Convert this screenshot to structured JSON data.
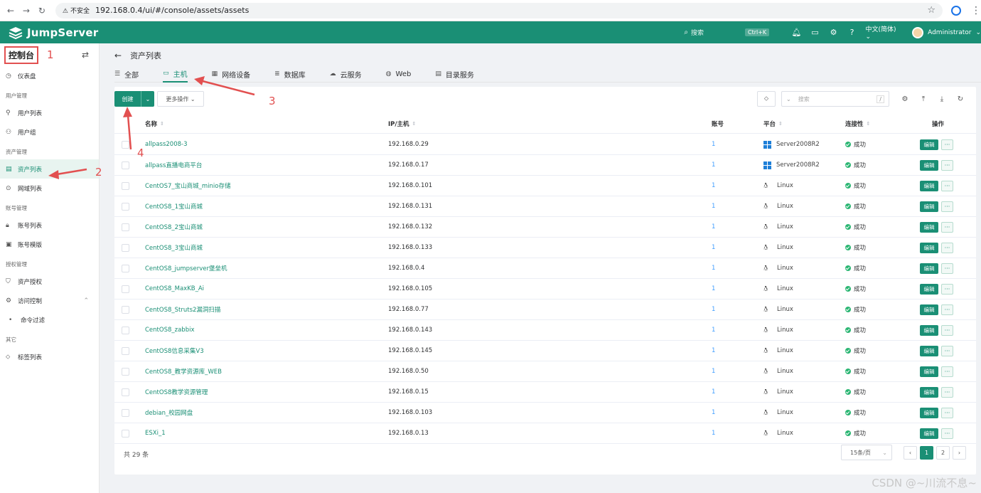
{
  "browser": {
    "security_label": "不安全",
    "url": "192.168.0.4/ui/#/console/assets/assets"
  },
  "header": {
    "logo_text": "JumpServer",
    "search_placeholder": "搜索",
    "search_shortcut": "Ctrl+K",
    "language": "中文(简体)",
    "username": "Administrator"
  },
  "sidebar": {
    "title": "控制台",
    "items": [
      {
        "type": "item",
        "label": "仪表盘",
        "icon": "dashboard-icon"
      },
      {
        "type": "group",
        "label": "用户管理"
      },
      {
        "type": "item",
        "label": "用户列表",
        "icon": "user-icon"
      },
      {
        "type": "item",
        "label": "用户组",
        "icon": "user-group-icon"
      },
      {
        "type": "group",
        "label": "资产管理"
      },
      {
        "type": "item",
        "label": "资产列表",
        "icon": "asset-icon",
        "active": true
      },
      {
        "type": "item",
        "label": "网域列表",
        "icon": "domain-icon"
      },
      {
        "type": "group",
        "label": "账号管理"
      },
      {
        "type": "item",
        "label": "账号列表",
        "icon": "lock-icon"
      },
      {
        "type": "item",
        "label": "账号模版",
        "icon": "template-icon"
      },
      {
        "type": "group",
        "label": "授权管理"
      },
      {
        "type": "item",
        "label": "资产授权",
        "icon": "shield-icon"
      },
      {
        "type": "item",
        "label": "访问控制",
        "icon": "access-control-icon",
        "expandable": true
      },
      {
        "type": "subitem",
        "label": "命令过滤"
      },
      {
        "type": "group",
        "label": "其它"
      },
      {
        "type": "item",
        "label": "标签列表",
        "icon": "tag-icon"
      }
    ]
  },
  "page": {
    "breadcrumb": "资产列表",
    "tabs": [
      {
        "label": "全部",
        "icon": "list-icon"
      },
      {
        "label": "主机",
        "icon": "host-icon",
        "active": true
      },
      {
        "label": "网络设备",
        "icon": "network-device-icon"
      },
      {
        "label": "数据库",
        "icon": "database-icon"
      },
      {
        "label": "云服务",
        "icon": "cloud-icon"
      },
      {
        "label": "Web",
        "icon": "globe-icon"
      },
      {
        "label": "目录服务",
        "icon": "directory-icon"
      }
    ]
  },
  "toolbar": {
    "create_label": "创建",
    "more_label": "更多操作",
    "search_placeholder": "搜索",
    "search_slash": "/"
  },
  "table": {
    "columns": {
      "name": "名称",
      "ip": "IP/主机",
      "accounts": "账号",
      "platform": "平台",
      "connectivity": "连接性",
      "actions": "操作"
    },
    "edit_label": "编辑",
    "more_label": "···",
    "rows": [
      {
        "name": "allpass2008-3",
        "ip": "192.168.0.29",
        "accounts": "1",
        "platform": "Server2008R2",
        "os": "windows",
        "connectivity": "成功"
      },
      {
        "name": "allpass直播电商平台",
        "ip": "192.168.0.17",
        "accounts": "1",
        "platform": "Server2008R2",
        "os": "windows",
        "connectivity": "成功"
      },
      {
        "name": "CentOS7_宝山商城_minio存储",
        "ip": "192.168.0.101",
        "accounts": "1",
        "platform": "Linux",
        "os": "linux",
        "connectivity": "成功"
      },
      {
        "name": "CentOS8_1宝山商城",
        "ip": "192.168.0.131",
        "accounts": "1",
        "platform": "Linux",
        "os": "linux",
        "connectivity": "成功"
      },
      {
        "name": "CentOS8_2宝山商城",
        "ip": "192.168.0.132",
        "accounts": "1",
        "platform": "Linux",
        "os": "linux",
        "connectivity": "成功"
      },
      {
        "name": "CentOS8_3宝山商城",
        "ip": "192.168.0.133",
        "accounts": "1",
        "platform": "Linux",
        "os": "linux",
        "connectivity": "成功"
      },
      {
        "name": "CentOS8_jumpserver堡垒机",
        "ip": "192.168.0.4",
        "accounts": "1",
        "platform": "Linux",
        "os": "linux",
        "connectivity": "成功"
      },
      {
        "name": "CentOS8_MaxKB_Ai",
        "ip": "192.168.0.105",
        "accounts": "1",
        "platform": "Linux",
        "os": "linux",
        "connectivity": "成功"
      },
      {
        "name": "CentOS8_Struts2漏洞扫描",
        "ip": "192.168.0.77",
        "accounts": "1",
        "platform": "Linux",
        "os": "linux",
        "connectivity": "成功"
      },
      {
        "name": "CentOS8_zabbix",
        "ip": "192.168.0.143",
        "accounts": "1",
        "platform": "Linux",
        "os": "linux",
        "connectivity": "成功"
      },
      {
        "name": "CentOS8信息采集V3",
        "ip": "192.168.0.145",
        "accounts": "1",
        "platform": "Linux",
        "os": "linux",
        "connectivity": "成功"
      },
      {
        "name": "CentOS8_教学资源库_WEB",
        "ip": "192.168.0.50",
        "accounts": "1",
        "platform": "Linux",
        "os": "linux",
        "connectivity": "成功"
      },
      {
        "name": "CentOS8教学资源管理",
        "ip": "192.168.0.15",
        "accounts": "1",
        "platform": "Linux",
        "os": "linux",
        "connectivity": "成功"
      },
      {
        "name": "debian_校园网盘",
        "ip": "192.168.0.103",
        "accounts": "1",
        "platform": "Linux",
        "os": "linux",
        "connectivity": "成功"
      },
      {
        "name": "ESXi_1",
        "ip": "192.168.0.13",
        "accounts": "1",
        "platform": "Linux",
        "os": "linux",
        "connectivity": "成功"
      }
    ]
  },
  "pagination": {
    "total": "共 29 条",
    "page_size": "15条/页",
    "pages": [
      "1",
      "2"
    ],
    "current": "1"
  },
  "annotations": {
    "markers": [
      "1",
      "2",
      "3",
      "4"
    ],
    "color": "#e25050"
  },
  "watermark_text": "CSDN @~川流不息~",
  "colors": {
    "brand": "#1a8f75",
    "link": "#409eff",
    "success": "#2bb673",
    "windows": "#1e7fd8"
  }
}
